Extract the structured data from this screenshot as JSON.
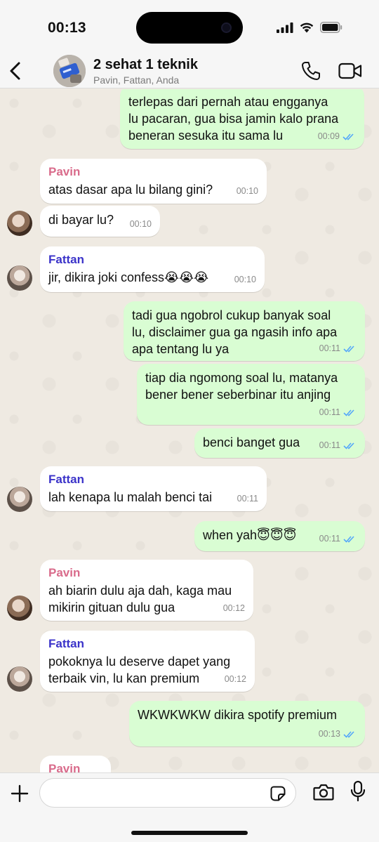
{
  "status_bar": {
    "time": "00:13"
  },
  "header": {
    "title": "2 sehat 1 teknik",
    "subtitle": "Pavin, Fattan, Anda"
  },
  "messages": [
    {
      "dir": "out",
      "text": "terlepas dari pernah atau engganya\nlu pacaran, gua bisa jamin kalo prana\nbeneran sesuka itu sama lu",
      "time": "00:09",
      "read": true
    },
    {
      "dir": "in",
      "sender": "Pavin",
      "text": "atas dasar apa lu bilang gini?",
      "time": "00:10"
    },
    {
      "dir": "in",
      "text": "di bayar lu?",
      "time": "00:10"
    },
    {
      "dir": "in",
      "sender": "Fattan",
      "text": "jir, dikira joki confess😭😭😭",
      "time": "00:10"
    },
    {
      "dir": "out",
      "text": "tadi gua ngobrol cukup banyak soal\nlu, disclaimer gua ga ngasih info apa\napa tentang lu ya",
      "time": "00:11",
      "read": true
    },
    {
      "dir": "out",
      "text": "tiap dia ngomong soal lu, matanya\nbener bener seberbinar itu anjing",
      "time": "00:11",
      "read": true
    },
    {
      "dir": "out",
      "text": "benci banget gua",
      "time": "00:11",
      "read": true
    },
    {
      "dir": "in",
      "sender": "Fattan",
      "text": "lah kenapa lu malah benci tai",
      "time": "00:11"
    },
    {
      "dir": "out",
      "text": "when yah😇😇😇",
      "time": "00:11",
      "read": true
    },
    {
      "dir": "in",
      "sender": "Pavin",
      "text": "ah biarin dulu aja dah, kaga mau\nmikirin gituan dulu gua",
      "time": "00:12"
    },
    {
      "dir": "in",
      "sender": "Fattan",
      "text": "pokoknya lu deserve dapet yang\nterbaik vin, lu kan premium",
      "time": "00:12"
    },
    {
      "dir": "out",
      "text": "WKWKWKW dikira spotify premium",
      "time": "00:13",
      "read": true
    },
    {
      "dir": "in",
      "sender": "Pavin",
      "text": "",
      "time": ""
    }
  ],
  "input": {
    "value": "",
    "placeholder": ""
  },
  "colors": {
    "outgoing_bubble": "#d9fdd3",
    "incoming_bubble": "#ffffff",
    "chat_background": "#efeae2",
    "pavin_name": "#d96b8b",
    "fattan_name": "#3b33c9",
    "read_ticks": "#53a6fa"
  },
  "icons": [
    "back-chevron-icon",
    "phone-icon",
    "video-camera-icon",
    "plus-icon",
    "sticker-icon",
    "camera-icon",
    "microphone-icon",
    "signal-icon",
    "wifi-icon",
    "battery-icon"
  ]
}
